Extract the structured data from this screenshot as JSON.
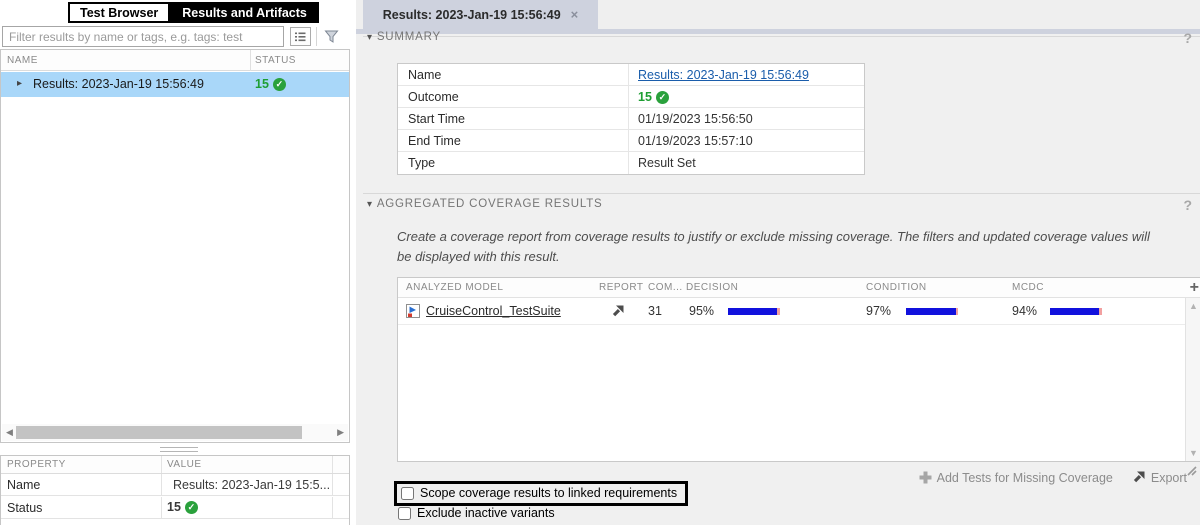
{
  "icons": {
    "collapse": "▾",
    "expand": "▸",
    "close": "×",
    "scroll_left": "◀",
    "scroll_right": "▶",
    "scroll_up": "▲",
    "scroll_down": "▼",
    "help": "?",
    "add_column": "+",
    "check": "✓"
  },
  "colors": {
    "selection_blue": "#a9d7f9",
    "active_tab": "#ced2de",
    "status_green": "#1e9e33",
    "link_blue": "#1a5dab",
    "bar_fill_blue": "#1111dd",
    "bar_remainder_pink": "#f2a0a0",
    "highlight_border": "#000000"
  },
  "left_panel": {
    "tabs": [
      {
        "label": "Test Browser",
        "active": false
      },
      {
        "label": "Results and Artifacts",
        "active": true
      }
    ],
    "filter": {
      "placeholder": "Filter results by name or tags, e.g. tags: test"
    },
    "tree": {
      "columns": {
        "name": "NAME",
        "status": "STATUS"
      },
      "rows": [
        {
          "name": "Results: 2023-Jan-19 15:56:49",
          "status_count": "15"
        }
      ]
    },
    "properties": {
      "columns": {
        "property": "PROPERTY",
        "value": "VALUE"
      },
      "rows": [
        {
          "property": "Name",
          "value": "Results: 2023-Jan-19 15:5..."
        },
        {
          "property": "Status",
          "value": "15"
        }
      ]
    }
  },
  "main": {
    "tab": {
      "title": "Results: 2023-Jan-19 15:56:49"
    },
    "summary": {
      "title": "SUMMARY",
      "rows": [
        {
          "label": "Name",
          "value": "Results: 2023-Jan-19 15:56:49"
        },
        {
          "label": "Outcome",
          "value": "15"
        },
        {
          "label": "Start Time",
          "value": "01/19/2023 15:56:50"
        },
        {
          "label": "End Time",
          "value": "01/19/2023 15:57:10"
        },
        {
          "label": "Type",
          "value": "Result Set"
        }
      ]
    },
    "coverage": {
      "title": "AGGREGATED COVERAGE RESULTS",
      "description": "Create a coverage report from coverage results to justify or exclude missing coverage. The filters and updated coverage values will be displayed with this result.",
      "columns": {
        "model": "ANALYZED MODEL",
        "report": "REPORT",
        "complexity": "COM...",
        "decision": "DECISION",
        "condition": "CONDITION",
        "mcdc": "MCDC"
      },
      "rows": [
        {
          "model": "CruiseControl_TestSuite",
          "complexity": "31",
          "decision": {
            "label": "95%",
            "value": 95
          },
          "condition": {
            "label": "97%",
            "value": 97
          },
          "mcdc": {
            "label": "94%",
            "value": 94
          }
        }
      ],
      "checkboxes": [
        {
          "label": "Scope coverage results to linked requirements",
          "checked": false
        },
        {
          "label": "Exclude inactive variants",
          "checked": false
        }
      ],
      "actions": [
        {
          "label": "Add Tests for Missing Coverage"
        },
        {
          "label": "Export"
        }
      ]
    }
  }
}
